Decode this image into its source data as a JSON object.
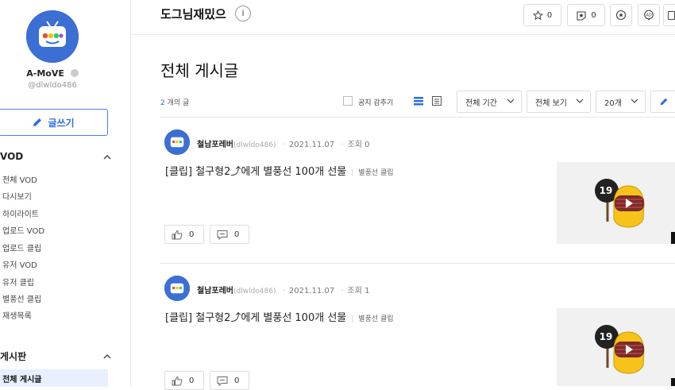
{
  "sidebar": {
    "channel_name": "A-MoVE",
    "channel_id": "@dlwldo486",
    "write_label": "글쓰기",
    "sections": [
      {
        "title": "VOD",
        "items": [
          {
            "label": "전체 VOD"
          },
          {
            "label": "다시보기"
          },
          {
            "label": "하이라이트"
          },
          {
            "label": "업로드 VOD"
          },
          {
            "label": "업로드 클립"
          },
          {
            "label": "유저 VOD"
          },
          {
            "label": "유저 클립"
          },
          {
            "label": "별풍선 클립"
          },
          {
            "label": "재생목록"
          }
        ]
      },
      {
        "title": "게시판",
        "items": [
          {
            "label": "전체 게시글"
          }
        ]
      }
    ]
  },
  "topbar": {
    "board_title": "도그님재밌으",
    "info_label": "i",
    "star_count": "0",
    "badge_count": "0"
  },
  "main": {
    "page_title": "전체 게시글",
    "post_count": "2",
    "post_count_suffix": " 개의 글",
    "notice_hide_label": "공지 감추기",
    "filters": {
      "period": "전체 기간",
      "view": "전체 보기",
      "per_page": "20개"
    },
    "posts": [
      {
        "author": "철남포레버",
        "author_id": "(dlwldo486)",
        "date": "2021.11.07",
        "views": "조회 0",
        "title": "[클립] 철구형2⤴에게 별풍선 100개 선물",
        "category": "별풍선 클립",
        "likes": "0",
        "comments": "0",
        "thumb_badge": "19"
      },
      {
        "author": "철남포레버",
        "author_id": "(dlwldo486)",
        "date": "2021.11.07",
        "views": "조회 1",
        "title": "[클립] 철구형2⤴에게 별풍선 100개 선물",
        "category": "별풍선 클립",
        "likes": "0",
        "comments": "0",
        "thumb_badge": "19"
      }
    ]
  },
  "colors": {
    "accent": "#2f6ce0",
    "avatar_bg": "#3b6fd4"
  }
}
